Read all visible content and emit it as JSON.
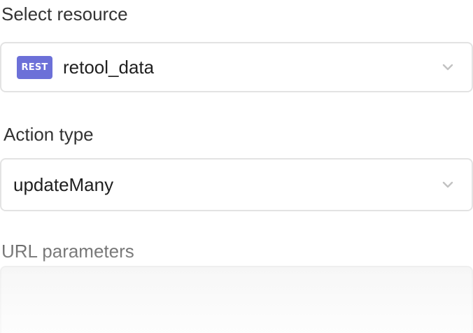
{
  "resource": {
    "label": "Select resource",
    "badge": "REST",
    "value": "retool_data",
    "badge_color": "#6c70d8"
  },
  "action": {
    "label": "Action type",
    "value": "updateMany"
  },
  "url_params": {
    "label": "URL parameters",
    "value": ""
  },
  "icons": {
    "dropdown": "chevron-down-icon"
  }
}
